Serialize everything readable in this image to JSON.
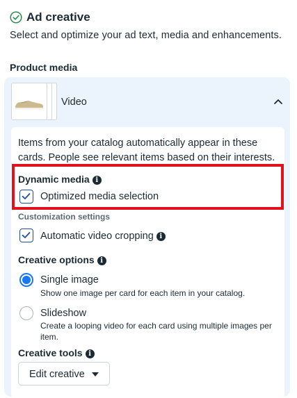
{
  "header": {
    "title": "Ad creative",
    "subtitle": "Select and optimize your ad text, media and enhancements."
  },
  "product_media": {
    "label": "Product media",
    "media_type": "Video",
    "info_text": "Items from your catalog automatically appear in these cards. People see relevant items based on their interests."
  },
  "dynamic_media": {
    "label": "Dynamic media",
    "option_label": "Optimized media selection",
    "checked": true
  },
  "customization": {
    "label": "Customization settings",
    "option_label": "Automatic video cropping",
    "checked": true
  },
  "creative_options": {
    "label": "Creative options",
    "options": [
      {
        "title": "Single image",
        "description": "Show one image per card for each item in your catalog.",
        "selected": true
      },
      {
        "title": "Slideshow",
        "description": "Create a looping video for each card using multiple images per item.",
        "selected": false
      }
    ]
  },
  "creative_tools": {
    "label": "Creative tools",
    "button_label": "Edit creative"
  },
  "colors": {
    "accent": "#1877f2",
    "highlight_box": "#e1121d",
    "panel_bg": "#ebf3fd"
  },
  "icons": [
    "check-circle-icon",
    "chevron-up-icon",
    "info-icon",
    "check-icon",
    "caret-down-icon"
  ]
}
